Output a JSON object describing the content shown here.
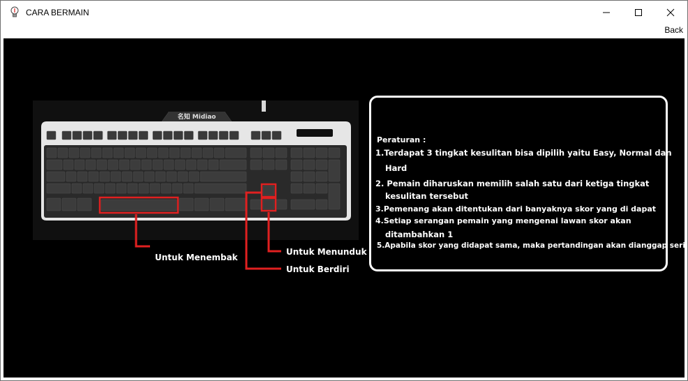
{
  "window": {
    "title": "CARA BERMAIN",
    "icon": "lightbulb-icon",
    "controls": {
      "minimize": "minimize-icon",
      "maximize": "maximize-icon",
      "close": "close-icon"
    }
  },
  "menu": {
    "back_label": "Back"
  },
  "keyboard": {
    "brand": "名知 Midiao",
    "label_space": "Untuk Menembak",
    "label_down": "Untuk Menunduk",
    "label_up": "Untuk Berdiri"
  },
  "rules": {
    "heading": "Peraturan :",
    "lines": [
      "1.Terdapat 3 tingkat kesulitan bisa dipilih yaitu Easy, Normal dan",
      "Hard",
      "2. Pemain diharuskan memilih salah satu dari ketiga tingkat",
      "kesulitan tersebut",
      "3.Pemenang akan ditentukan dari banyaknya skor yang di dapat",
      "4.Setiap serangan pemain yang mengenai lawan skor akan",
      "ditambahkan 1",
      "5.Apabila skor yang didapat sama, maka pertandingan akan dianggap seri"
    ]
  },
  "colors": {
    "background": "#000000",
    "highlight": "#e02020",
    "text": "#ffffff"
  }
}
